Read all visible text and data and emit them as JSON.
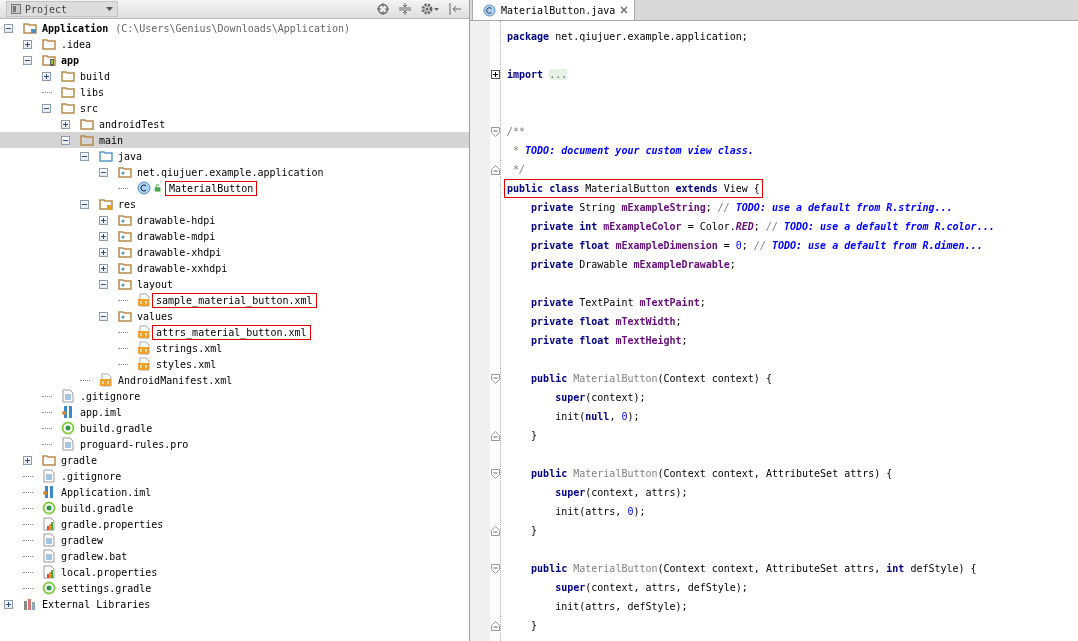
{
  "project_panel": {
    "title": "Project",
    "tree": [
      {
        "name": "Application",
        "path": "(C:\\Users\\Genius\\Downloads\\Application)",
        "kind": "project",
        "expanded": true,
        "selected": false,
        "children": [
          {
            "name": ".idea",
            "kind": "folder",
            "expanded": false,
            "selected": false
          },
          {
            "name": "app",
            "kind": "module",
            "expanded": true,
            "selected": false,
            "children": [
              {
                "name": "build",
                "kind": "folder",
                "expanded": false,
                "selected": false
              },
              {
                "name": "libs",
                "kind": "folder",
                "selected": false
              },
              {
                "name": "src",
                "kind": "folder",
                "expanded": true,
                "selected": false,
                "children": [
                  {
                    "name": "androidTest",
                    "kind": "folder",
                    "expanded": false,
                    "selected": false
                  },
                  {
                    "name": "main",
                    "kind": "folder",
                    "expanded": true,
                    "selected": true,
                    "children": [
                      {
                        "name": "java",
                        "kind": "source",
                        "expanded": true,
                        "selected": false,
                        "children": [
                          {
                            "name": "net.qiujuer.example.application",
                            "kind": "package",
                            "expanded": true,
                            "selected": false,
                            "children": [
                              {
                                "name": "MaterialButton",
                                "kind": "class",
                                "selected": false,
                                "annotated": true
                              }
                            ]
                          }
                        ]
                      },
                      {
                        "name": "res",
                        "kind": "res",
                        "expanded": true,
                        "selected": false,
                        "children": [
                          {
                            "name": "drawable-hdpi",
                            "kind": "package",
                            "expanded": false,
                            "selected": false
                          },
                          {
                            "name": "drawable-mdpi",
                            "kind": "package",
                            "expanded": false,
                            "selected": false
                          },
                          {
                            "name": "drawable-xhdpi",
                            "kind": "package",
                            "expanded": false,
                            "selected": false
                          },
                          {
                            "name": "drawable-xxhdpi",
                            "kind": "package",
                            "expanded": false,
                            "selected": false
                          },
                          {
                            "name": "layout",
                            "kind": "package",
                            "expanded": true,
                            "selected": false,
                            "children": [
                              {
                                "name": "sample_material_button.xml",
                                "kind": "xml",
                                "selected": false,
                                "annotated": true
                              }
                            ]
                          },
                          {
                            "name": "values",
                            "kind": "package",
                            "expanded": true,
                            "selected": false,
                            "children": [
                              {
                                "name": "attrs_material_button.xml",
                                "kind": "xml",
                                "selected": false,
                                "annotated": true
                              },
                              {
                                "name": "strings.xml",
                                "kind": "xml",
                                "selected": false
                              },
                              {
                                "name": "styles.xml",
                                "kind": "xml",
                                "selected": false
                              }
                            ]
                          }
                        ]
                      },
                      {
                        "name": "AndroidManifest.xml",
                        "kind": "xml",
                        "selected": false
                      }
                    ]
                  }
                ]
              },
              {
                "name": ".gitignore",
                "kind": "text",
                "selected": false
              },
              {
                "name": "app.iml",
                "kind": "iml",
                "selected": false
              },
              {
                "name": "build.gradle",
                "kind": "gradle",
                "selected": false
              },
              {
                "name": "proguard-rules.pro",
                "kind": "text",
                "selected": false
              }
            ]
          },
          {
            "name": "gradle",
            "kind": "folder",
            "expanded": false,
            "selected": false
          },
          {
            "name": ".gitignore",
            "kind": "text",
            "selected": false
          },
          {
            "name": "Application.iml",
            "kind": "iml",
            "selected": false
          },
          {
            "name": "build.gradle",
            "kind": "gradle",
            "selected": false
          },
          {
            "name": "gradle.properties",
            "kind": "properties",
            "selected": false
          },
          {
            "name": "gradlew",
            "kind": "text",
            "selected": false
          },
          {
            "name": "gradlew.bat",
            "kind": "text",
            "selected": false
          },
          {
            "name": "local.properties",
            "kind": "properties",
            "selected": false
          },
          {
            "name": "settings.gradle",
            "kind": "gradle",
            "selected": false
          }
        ]
      },
      {
        "name": "External Libraries",
        "kind": "libraries",
        "expanded": false,
        "selected": false
      }
    ]
  },
  "editor": {
    "tabs": [
      {
        "label": "MaterialButton.java",
        "selected": true
      }
    ],
    "lines": [
      {
        "kind": "code",
        "tokens": [
          {
            "kind": "keyword",
            "text": "package"
          },
          {
            "kind": "plain",
            "text": " net.qiujuer.example.application;"
          }
        ]
      },
      {
        "kind": "blank"
      },
      {
        "kind": "code",
        "collapsed": true,
        "tokens": [
          {
            "kind": "keyword",
            "text": "import "
          },
          {
            "kind": "folded",
            "text": "..."
          }
        ]
      },
      {
        "kind": "blank"
      },
      {
        "kind": "blank"
      },
      {
        "kind": "code",
        "fold_start": true,
        "tokens": [
          {
            "kind": "comment",
            "text": "/**"
          }
        ]
      },
      {
        "kind": "code",
        "tokens": [
          {
            "kind": "comment",
            "text": " * "
          },
          {
            "kind": "todo",
            "text": "TODO: document your custom view class."
          }
        ]
      },
      {
        "kind": "code",
        "fold_end": true,
        "tokens": [
          {
            "kind": "comment",
            "text": " */"
          }
        ]
      },
      {
        "kind": "code",
        "annotated": true,
        "tokens": [
          {
            "kind": "keyword",
            "text": "public class"
          },
          {
            "kind": "plain",
            "text": " MaterialButton "
          },
          {
            "kind": "keyword",
            "text": "extends"
          },
          {
            "kind": "plain",
            "text": " View {"
          }
        ]
      },
      {
        "kind": "code",
        "tokens": [
          {
            "kind": "keyword",
            "text": "    private"
          },
          {
            "kind": "plain",
            "text": " String "
          },
          {
            "kind": "field",
            "text": "mExampleString"
          },
          {
            "kind": "plain",
            "text": "; "
          },
          {
            "kind": "comment",
            "text": "// "
          },
          {
            "kind": "todo",
            "text": "TODO: use a default from R.string..."
          }
        ]
      },
      {
        "kind": "code",
        "tokens": [
          {
            "kind": "keyword",
            "text": "    private int "
          },
          {
            "kind": "field",
            "text": "mExampleColor"
          },
          {
            "kind": "plain",
            "text": " = Color."
          },
          {
            "kind": "constant",
            "text": "RED"
          },
          {
            "kind": "plain",
            "text": "; "
          },
          {
            "kind": "comment",
            "text": "// "
          },
          {
            "kind": "todo",
            "text": "TODO: use a default from R.color..."
          }
        ]
      },
      {
        "kind": "code",
        "tokens": [
          {
            "kind": "keyword",
            "text": "    private float "
          },
          {
            "kind": "field",
            "text": "mExampleDimension"
          },
          {
            "kind": "plain",
            "text": " = "
          },
          {
            "kind": "number",
            "text": "0"
          },
          {
            "kind": "plain",
            "text": "; "
          },
          {
            "kind": "comment",
            "text": "// "
          },
          {
            "kind": "todo",
            "text": "TODO: use a default from R.dimen..."
          }
        ]
      },
      {
        "kind": "code",
        "tokens": [
          {
            "kind": "keyword",
            "text": "    private"
          },
          {
            "kind": "plain",
            "text": " Drawable "
          },
          {
            "kind": "field",
            "text": "mExampleDrawable"
          },
          {
            "kind": "plain",
            "text": ";"
          }
        ]
      },
      {
        "kind": "blank"
      },
      {
        "kind": "code",
        "tokens": [
          {
            "kind": "keyword",
            "text": "    private"
          },
          {
            "kind": "plain",
            "text": " TextPaint "
          },
          {
            "kind": "field",
            "text": "mTextPaint"
          },
          {
            "kind": "plain",
            "text": ";"
          }
        ]
      },
      {
        "kind": "code",
        "tokens": [
          {
            "kind": "keyword",
            "text": "    private float "
          },
          {
            "kind": "field",
            "text": "mTextWidth"
          },
          {
            "kind": "plain",
            "text": ";"
          }
        ]
      },
      {
        "kind": "code",
        "tokens": [
          {
            "kind": "keyword",
            "text": "    private float "
          },
          {
            "kind": "field",
            "text": "mTextHeight"
          },
          {
            "kind": "plain",
            "text": ";"
          }
        ]
      },
      {
        "kind": "blank"
      },
      {
        "kind": "code",
        "fold_start": true,
        "tokens": [
          {
            "kind": "keyword",
            "text": "    public "
          },
          {
            "kind": "unused",
            "text": "MaterialButton"
          },
          {
            "kind": "plain",
            "text": "(Context context) {"
          }
        ]
      },
      {
        "kind": "code",
        "tokens": [
          {
            "kind": "keyword",
            "text": "        super"
          },
          {
            "kind": "plain",
            "text": "(context);"
          }
        ]
      },
      {
        "kind": "code",
        "tokens": [
          {
            "kind": "plain",
            "text": "        init("
          },
          {
            "kind": "keyword",
            "text": "null"
          },
          {
            "kind": "plain",
            "text": ", "
          },
          {
            "kind": "number",
            "text": "0"
          },
          {
            "kind": "plain",
            "text": ");"
          }
        ]
      },
      {
        "kind": "code",
        "fold_end": true,
        "tokens": [
          {
            "kind": "plain",
            "text": "    }"
          }
        ]
      },
      {
        "kind": "blank"
      },
      {
        "kind": "code",
        "fold_start": true,
        "tokens": [
          {
            "kind": "keyword",
            "text": "    public "
          },
          {
            "kind": "unused",
            "text": "MaterialButton"
          },
          {
            "kind": "plain",
            "text": "(Context context, AttributeSet attrs) {"
          }
        ]
      },
      {
        "kind": "code",
        "tokens": [
          {
            "kind": "keyword",
            "text": "        super"
          },
          {
            "kind": "plain",
            "text": "(context, attrs);"
          }
        ]
      },
      {
        "kind": "code",
        "tokens": [
          {
            "kind": "plain",
            "text": "        init(attrs, "
          },
          {
            "kind": "number",
            "text": "0"
          },
          {
            "kind": "plain",
            "text": ");"
          }
        ]
      },
      {
        "kind": "code",
        "fold_end": true,
        "tokens": [
          {
            "kind": "plain",
            "text": "    }"
          }
        ]
      },
      {
        "kind": "blank"
      },
      {
        "kind": "code",
        "fold_start": true,
        "tokens": [
          {
            "kind": "keyword",
            "text": "    public "
          },
          {
            "kind": "unused",
            "text": "MaterialButton"
          },
          {
            "kind": "plain",
            "text": "(Context context, AttributeSet attrs, "
          },
          {
            "kind": "keyword",
            "text": "int"
          },
          {
            "kind": "plain",
            "text": " defStyle) {"
          }
        ]
      },
      {
        "kind": "code",
        "tokens": [
          {
            "kind": "keyword",
            "text": "        super"
          },
          {
            "kind": "plain",
            "text": "(context, attrs, defStyle);"
          }
        ]
      },
      {
        "kind": "code",
        "tokens": [
          {
            "kind": "plain",
            "text": "        init(attrs, defStyle);"
          }
        ]
      },
      {
        "kind": "code",
        "fold_end": true,
        "tokens": [
          {
            "kind": "plain",
            "text": "    }"
          }
        ]
      }
    ]
  }
}
